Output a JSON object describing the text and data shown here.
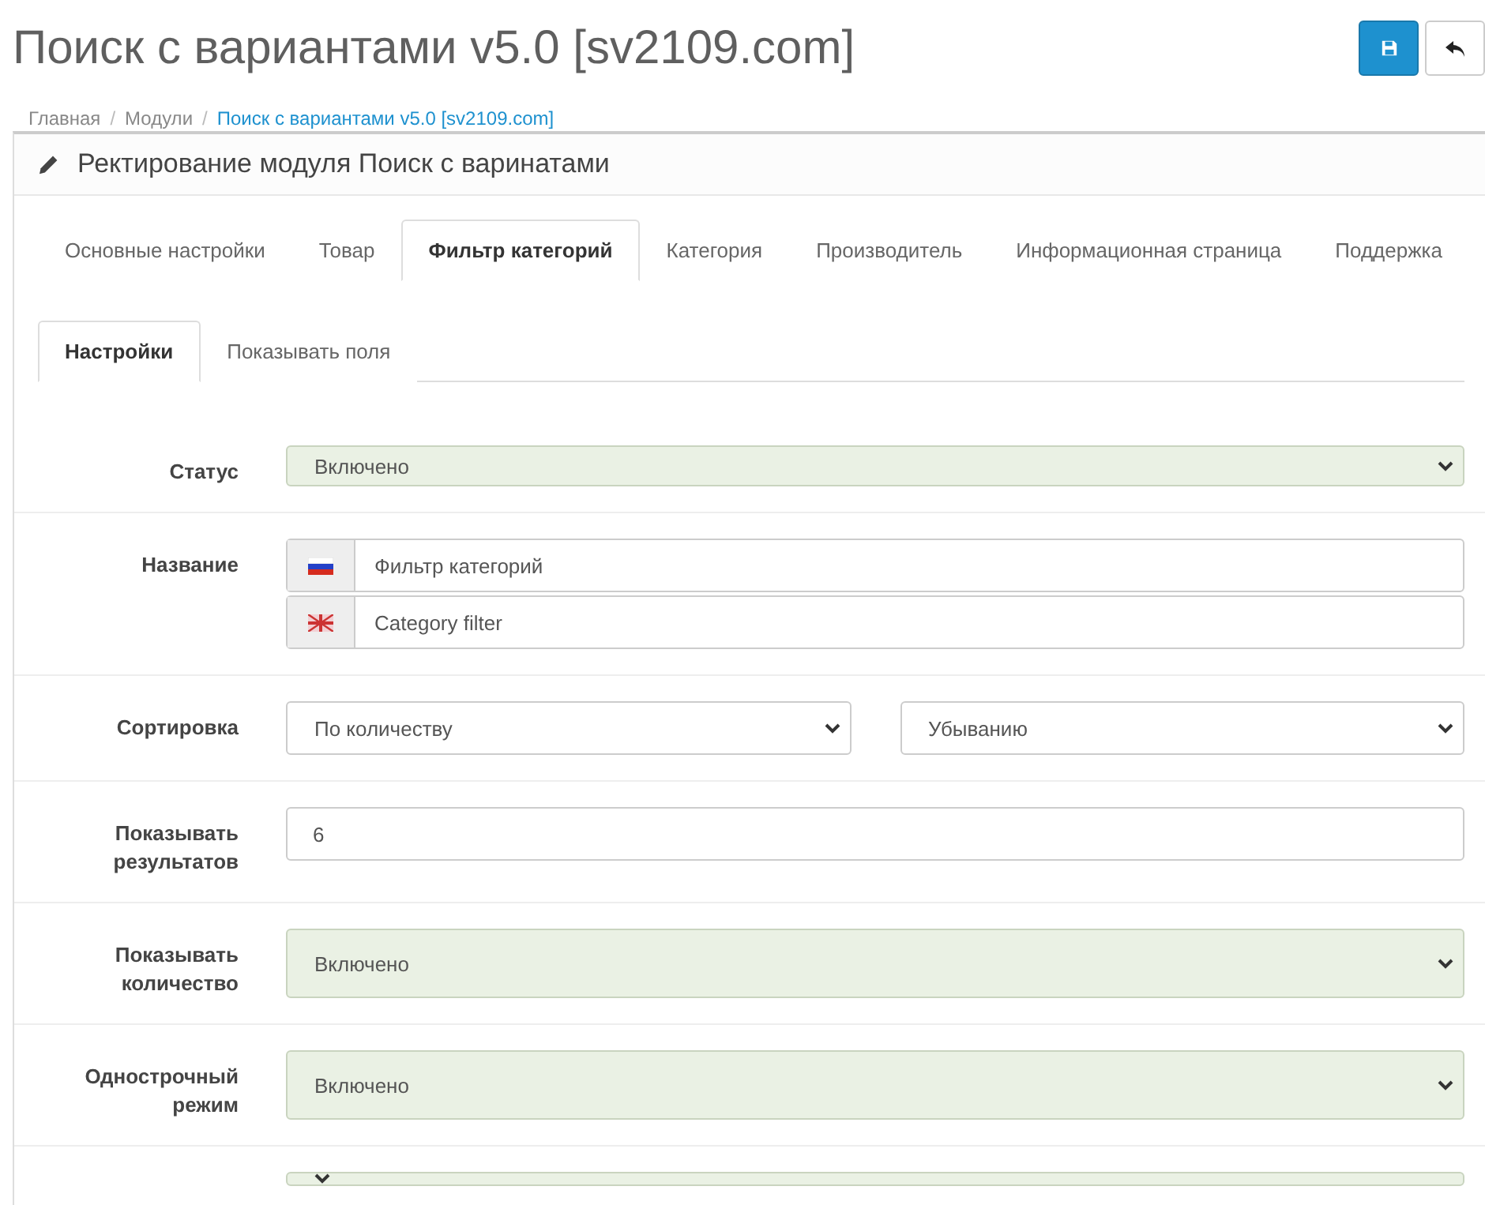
{
  "title": "Поиск с вариантами v5.0 [sv2109.com]",
  "breadcrumb_separator": "/",
  "breadcrumb": [
    {
      "label": "Главная",
      "current": false
    },
    {
      "label": "Модули",
      "current": false
    },
    {
      "label": "Поиск с вариантами v5.0 [sv2109.com]",
      "current": true
    }
  ],
  "panel_title": "Ректирование модуля Поиск с варинатами",
  "tabs": [
    {
      "label": "Основные настройки",
      "selected": false
    },
    {
      "label": "Товар",
      "selected": false
    },
    {
      "label": "Фильтр категорий",
      "selected": true
    },
    {
      "label": "Категория",
      "selected": false
    },
    {
      "label": "Производитель",
      "selected": false
    },
    {
      "label": "Информационная страница",
      "selected": false
    },
    {
      "label": "Поддержка",
      "selected": false
    }
  ],
  "subtabs": [
    {
      "label": "Настройки",
      "selected": true
    },
    {
      "label": "Показывать поля",
      "selected": false
    }
  ],
  "rows": [
    {
      "kind": "select",
      "label": "Статус",
      "value": "Включено",
      "highlighted": true
    },
    {
      "kind": "lang_inputs",
      "label": "Название",
      "inputs": [
        {
          "kind": "ru",
          "value": "Фильтр категорий"
        },
        {
          "kind": "en",
          "value": "Category filter"
        }
      ]
    },
    {
      "kind": "select_pair",
      "label": "Сортировка",
      "selects": [
        {
          "value": "По количеству",
          "highlighted": false
        },
        {
          "value": "Убыванию",
          "highlighted": false
        }
      ]
    },
    {
      "kind": "input",
      "label": "Показывать результатов",
      "value": "6"
    },
    {
      "kind": "select",
      "label": "Показывать количество",
      "value": "Включено",
      "highlighted": true
    },
    {
      "kind": "select",
      "label": "Однострочный режим",
      "value": "Включено",
      "highlighted": true
    },
    {
      "kind": "select",
      "value": "",
      "highlighted": true
    }
  ]
}
